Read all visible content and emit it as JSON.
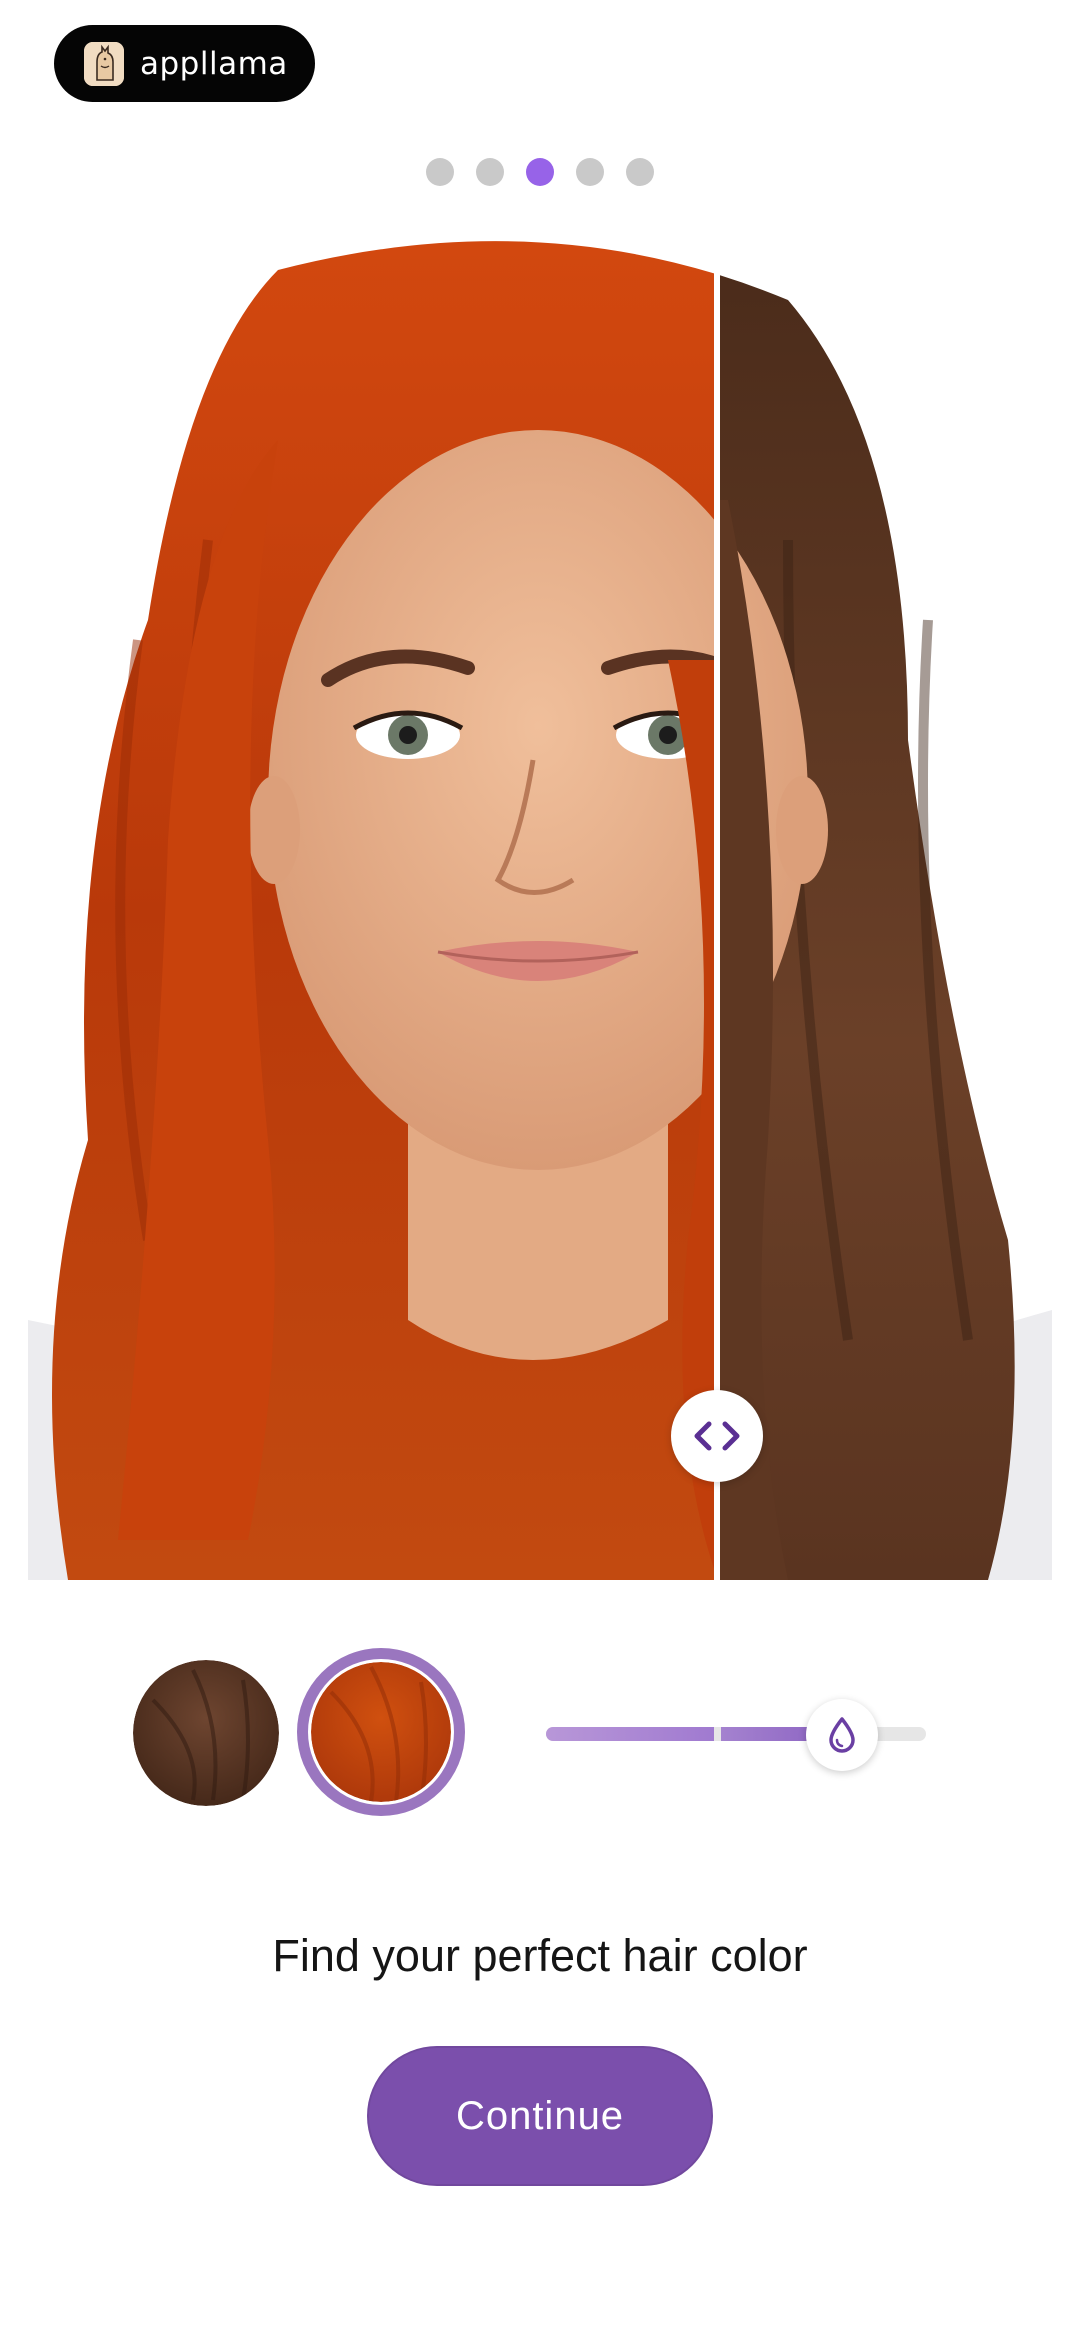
{
  "brand": {
    "name": "appllama",
    "logo_icon": "llama-icon"
  },
  "pager": {
    "count": 5,
    "active_index": 2,
    "active_color": "#9763e8",
    "inactive_color": "#c9c9c9"
  },
  "comparison": {
    "before_hair_color": "#c53f0b",
    "after_hair_color": "#5a3420",
    "handle_icon": "chevrons-left-right-icon"
  },
  "swatches": [
    {
      "name": "brown",
      "color": "#5b3723",
      "selected": false
    },
    {
      "name": "copper-red",
      "color": "#c4410c",
      "selected": true
    }
  ],
  "intensity_slider": {
    "value": 0.78,
    "thumb_icon": "droplet-icon",
    "accent": "#7b4fac"
  },
  "headline": "Find your perfect hair color",
  "cta": {
    "label": "Continue",
    "color": "#7b4fac"
  }
}
